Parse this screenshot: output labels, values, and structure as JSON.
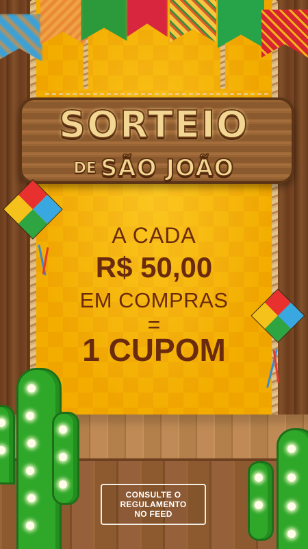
{
  "title": {
    "main": "SORTEIO",
    "prefix": "DE",
    "subtitle": "SÃO JOÃO"
  },
  "promo": {
    "line1": "A CADA",
    "line2": "R$ 50,00",
    "line3": "EM COMPRAS",
    "line4": "=",
    "line5": "1 CUPOM"
  },
  "cta": {
    "line1": "CONSULTE O",
    "line2": "REGULAMENTO",
    "line3": "NO FEED"
  },
  "colors": {
    "background_yellow": "#f7b500",
    "text_brown": "#6a2a0e",
    "title_cream": "#f2d693",
    "cactus_green": "#2fa82a"
  },
  "icons": [
    "bunting-flag",
    "paper-balloon",
    "cactus",
    "marquee-bulb"
  ]
}
